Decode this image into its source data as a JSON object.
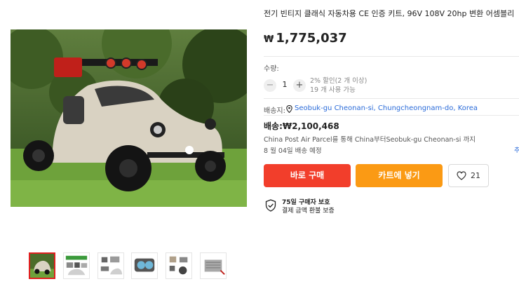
{
  "product": {
    "title": "전기 빈티지 클래식 자동차용 CE 인증 키트, 96V 108V 20hp 변환 어셈블리",
    "currency_symbol": "₩",
    "price": "1,775,037"
  },
  "quantity": {
    "label": "수량:",
    "minus": "−",
    "value": "1",
    "plus": "+",
    "discount_line1": "2% 할인(2 개 이상)",
    "discount_line2": "19 개 사용 가능"
  },
  "shipping": {
    "to_label": "배송지:",
    "to_value": "Seobuk-gu Cheonan-si, Chungcheongnam-do, Korea",
    "cost": "배송:₩2,100,468",
    "method": "China Post Air Parcel를 통해 China부터Seobuk-gu Cheonan-si 까지",
    "eta": "8 월 04일 배송 예정",
    "more_link": "추"
  },
  "actions": {
    "buy_now": "바로 구매",
    "add_to_cart": "카트에 넣기",
    "wishlist_count": "21"
  },
  "protection": {
    "title": "75일 구매자 보호",
    "subtitle": "결제 금액 환불 보증"
  },
  "colors": {
    "buy_button": "#f23e2b",
    "cart_button": "#fb9a14",
    "link": "#2a6bd9",
    "active_thumb_border": "#e02020"
  },
  "icons": {
    "location": "map-pin-icon",
    "wishlist": "heart-icon",
    "protection": "shield-check-icon"
  }
}
